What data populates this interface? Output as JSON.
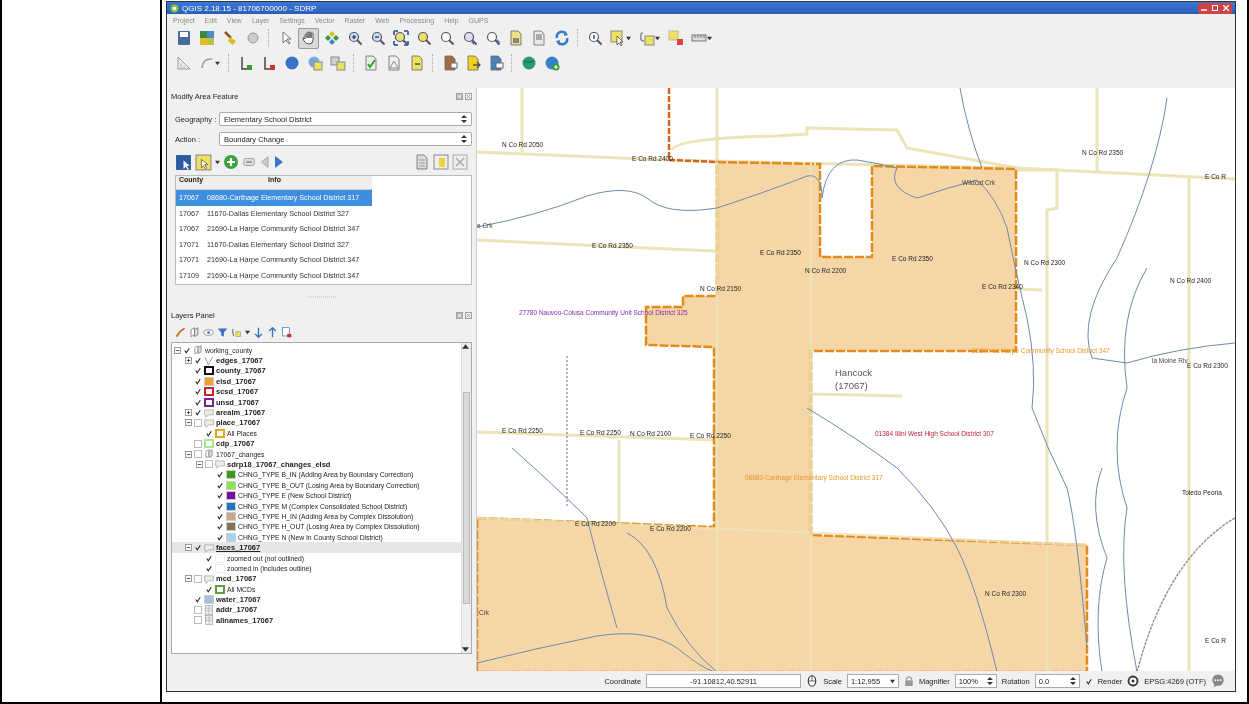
{
  "window": {
    "title": "QGIS 2.18.15 - 81706700000 - SDRP"
  },
  "menu": [
    "Project",
    "Edit",
    "View",
    "Layer",
    "Settings",
    "Vector",
    "Raster",
    "Web",
    "Processing",
    "Help",
    "GUPS"
  ],
  "toolbars": [
    {
      "tools": [
        {
          "selected": false
        },
        {
          "selected": false
        },
        {
          "selected": false
        },
        {
          "selected": false
        },
        {
          "selected": false
        },
        {
          "selected": true
        },
        {
          "selected": false
        },
        {
          "selected": false
        },
        {
          "selected": false
        },
        {
          "selected": false
        },
        {
          "selected": false
        },
        {
          "selected": false
        },
        {
          "selected": false
        },
        {
          "selected": false
        },
        {
          "selected": false
        },
        {
          "selected": false
        },
        {
          "selected": false
        },
        {
          "selected": false
        },
        {
          "selected": false
        },
        {
          "selected": false
        },
        {
          "selected": false
        },
        {
          "selected": false
        }
      ]
    },
    {
      "tools": [
        {
          "selected": false
        },
        {
          "selected": false
        },
        {
          "selected": false
        },
        {
          "selected": false
        },
        {
          "selected": false
        },
        {
          "selected": false
        },
        {
          "selected": false
        },
        {
          "selected": false
        },
        {
          "selected": false
        },
        {
          "selected": false
        },
        {
          "selected": false
        },
        {
          "selected": false
        },
        {
          "selected": false
        },
        {
          "selected": false
        },
        {
          "selected": false
        }
      ]
    }
  ],
  "modify_panel": {
    "title": "Modify Area Feature",
    "fields": [
      {
        "label": "Geography :",
        "value": "Elementary School District"
      },
      {
        "label": "Action :",
        "value": "Boundary Change"
      }
    ],
    "table": {
      "columns": [
        "County",
        "Info"
      ],
      "rows": [
        {
          "cells": [
            "17067",
            "08680-Carthage Elementary School District 317"
          ],
          "selected": true
        },
        {
          "cells": [
            "17067",
            "11670-Dallas Elementary School District 327"
          ],
          "selected": false
        },
        {
          "cells": [
            "17067",
            "21690-La Harpe Community School District 347"
          ],
          "selected": false
        },
        {
          "cells": [
            "17071",
            "11670-Dallas Elementary School District 327"
          ],
          "selected": false
        },
        {
          "cells": [
            "17071",
            "21690-La Harpe Community School District 347"
          ],
          "selected": false
        },
        {
          "cells": [
            "17109",
            "21690-La Harpe Community School District 347"
          ],
          "selected": false
        }
      ]
    }
  },
  "layers_panel": {
    "title": "Layers Panel",
    "tree": [
      {
        "name": "working_county",
        "kind": "group",
        "checked": true,
        "selected": false,
        "expanded": true,
        "children": [
          {
            "name": "edges_17067",
            "kind": "line",
            "checked": true,
            "selected": false,
            "expanded": false
          },
          {
            "name": "county_17067",
            "kind": "outline",
            "color": "#111111",
            "checked": true,
            "selected": false
          },
          {
            "name": "elsd_17067",
            "kind": "fill",
            "color": "#f0a030",
            "checked": true,
            "selected": false
          },
          {
            "name": "scsd_17067",
            "kind": "outline",
            "color": "#d02030",
            "checked": true,
            "selected": false
          },
          {
            "name": "unsd_17067",
            "kind": "outline",
            "color": "#7a2090",
            "checked": true,
            "selected": false
          },
          {
            "name": "arealm_17067",
            "kind": "polygon",
            "checked": true,
            "selected": false,
            "expanded": false
          },
          {
            "name": "place_17067",
            "kind": "polygon",
            "checked": false,
            "selected": false,
            "expanded": true,
            "children": [
              {
                "name": "All Places",
                "kind": "outline",
                "color": "#e0a820",
                "checked": true,
                "selected": false
              }
            ]
          },
          {
            "name": "cdp_17067",
            "kind": "outline",
            "color": "#a8e890",
            "checked": false,
            "selected": false
          },
          {
            "name": "17067_changes",
            "kind": "group",
            "checked": false,
            "selected": false,
            "expanded": true,
            "children": [
              {
                "name": "sdrp18_17067_changes_elsd",
                "kind": "polygon",
                "checked": false,
                "selected": false,
                "expanded": true,
                "children": [
                  {
                    "name": "CHNG_TYPE B_IN (Adding Area by Boundary Correction)",
                    "kind": "fill",
                    "color": "#3a9a20",
                    "checked": true,
                    "selected": false
                  },
                  {
                    "name": "CHNG_TYPE B_OUT (Losing Area by Boundary Correction)",
                    "kind": "fill",
                    "color": "#86e850",
                    "checked": true,
                    "selected": false
                  },
                  {
                    "name": "CHNG_TYPE E (New School District)",
                    "kind": "fill",
                    "color": "#7a0a9a",
                    "checked": true,
                    "selected": false
                  },
                  {
                    "name": "CHNG_TYPE M (Complex Consolidated School District)",
                    "kind": "fill",
                    "color": "#1a78b8",
                    "checked": true,
                    "selected": false
                  },
                  {
                    "name": "CHNG_TYPE H_IN (Adding Area by Complex Dissolution)",
                    "kind": "fill",
                    "color": "#c8a888",
                    "checked": true,
                    "selected": false
                  },
                  {
                    "name": "CHNG_TYPE H_OUT (Losing Area by Complex Dissolution)",
                    "kind": "fill",
                    "color": "#85715a",
                    "checked": true,
                    "selected": false
                  },
                  {
                    "name": "CHNG_TYPE N (New In County School District)",
                    "kind": "fill",
                    "color": "#a8d4f0",
                    "checked": true,
                    "selected": false
                  }
                ]
              }
            ]
          },
          {
            "name": "faces_17067",
            "kind": "polygon",
            "checked": true,
            "selected": true,
            "expanded": true,
            "children": [
              {
                "name": "zoomed out (not outlined)",
                "kind": "blank",
                "checked": true,
                "selected": false
              },
              {
                "name": "zoomed in (includes outline)",
                "kind": "blank",
                "checked": true,
                "selected": false
              }
            ]
          },
          {
            "name": "mcd_17067",
            "kind": "polygon",
            "checked": false,
            "selected": false,
            "expanded": true,
            "children": [
              {
                "name": "All MCDs",
                "kind": "outline",
                "color": "#60a040",
                "checked": true,
                "selected": false
              }
            ]
          },
          {
            "name": "water_17067",
            "kind": "fill",
            "color": "#a8c0e0",
            "checked": true,
            "selected": false
          },
          {
            "name": "addr_17067",
            "kind": "table",
            "checked": false,
            "selected": false
          },
          {
            "name": "allnames_17067",
            "kind": "table",
            "checked": false,
            "selected": false
          }
        ]
      }
    ]
  },
  "map": {
    "labels": [
      {
        "text": "N Co Rd 2050",
        "kind": "road"
      },
      {
        "text": "E Co Rd 2400",
        "kind": "road"
      },
      {
        "text": "N Co Rd 2350",
        "kind": "road"
      },
      {
        "text": "E Co R",
        "kind": "road"
      },
      {
        "text": "Wildcat Crk",
        "kind": "water"
      },
      {
        "text": "e Crk",
        "kind": "water"
      },
      {
        "text": "E Co Rd 2350",
        "kind": "road"
      },
      {
        "text": "E Co Rd 2350",
        "kind": "road"
      },
      {
        "text": "N Co Rd 2200",
        "kind": "road"
      },
      {
        "text": "E Co Rd 2350",
        "kind": "road"
      },
      {
        "text": "E Co Rd 2340",
        "kind": "road"
      },
      {
        "text": "N Co Rd 2300",
        "kind": "road"
      },
      {
        "text": "N Co Rd 2400",
        "kind": "road"
      },
      {
        "text": "N Co Rd 2150",
        "kind": "road"
      },
      {
        "text": "27780 Nauvoo-Colusa Community Unit School District 325",
        "kind": "unified"
      },
      {
        "text": "21690-La Harpe Community School District 347",
        "kind": "elementary"
      },
      {
        "text": "la Moine Riv",
        "kind": "water"
      },
      {
        "text": "E Co Rd 2300",
        "kind": "road"
      },
      {
        "text": "Hancock",
        "kind": "county"
      },
      {
        "text": "(17067)",
        "kind": "county"
      },
      {
        "text": "E Co Rd 2250",
        "kind": "road"
      },
      {
        "text": "E Co Rd 2250",
        "kind": "road"
      },
      {
        "text": "N Co Rd 2100",
        "kind": "road"
      },
      {
        "text": "E Co Rd 2250",
        "kind": "road"
      },
      {
        "text": "01384 Illini West High School District 307",
        "kind": "secondary"
      },
      {
        "text": "08680-Carthage Elementary School District 317",
        "kind": "elementary"
      },
      {
        "text": "Toledo Peoria",
        "kind": "rail"
      },
      {
        "text": "E Co Rd 2200",
        "kind": "road"
      },
      {
        "text": "E Co Rd 2200",
        "kind": "road"
      },
      {
        "text": "N Co Rd 2300",
        "kind": "road"
      },
      {
        "text": "Crk",
        "kind": "water"
      },
      {
        "text": "E Co R",
        "kind": "road"
      }
    ]
  },
  "status_bar": {
    "coordinate_label": "Coordinate",
    "coordinate": "-91.10812,40.52911",
    "scale_label": "Scale",
    "scale": "1:12,955",
    "magnifier_label": "Magnifier",
    "magnifier": "100%",
    "rotation_label": "Rotation",
    "rotation": "0.0",
    "render_label": "Render",
    "render": true,
    "crs": "EPSG:4269 (OTF)"
  }
}
